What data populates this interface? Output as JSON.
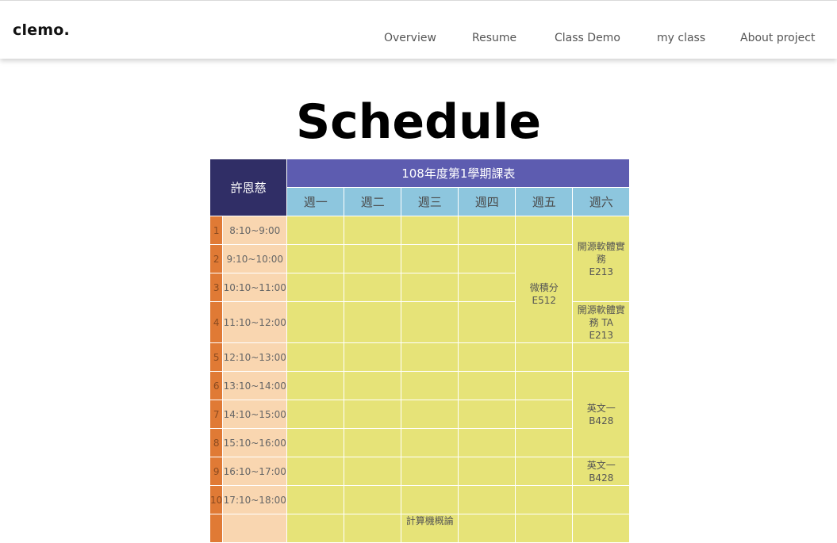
{
  "header": {
    "brand": "clemo.",
    "nav": [
      "Overview",
      "Resume",
      "Class Demo",
      "my class",
      "About project"
    ]
  },
  "page_title": "Schedule",
  "schedule": {
    "owner": "許恩慈",
    "semester_title": "108年度第1學期課表",
    "days": [
      "週一",
      "週二",
      "週三",
      "週四",
      "週五",
      "週六"
    ],
    "periods": [
      {
        "num": "1",
        "time": "8:10~9:00"
      },
      {
        "num": "2",
        "time": "9:10~10:00"
      },
      {
        "num": "3",
        "time": "10:10~11:00"
      },
      {
        "num": "4",
        "time": "11:10~12:00"
      },
      {
        "num": "5",
        "time": "12:10~13:00"
      },
      {
        "num": "6",
        "time": "13:10~14:00"
      },
      {
        "num": "7",
        "time": "14:10~15:00"
      },
      {
        "num": "8",
        "time": "15:10~16:00"
      },
      {
        "num": "9",
        "time": "16:10~17:00"
      },
      {
        "num": "10",
        "time": "17:10~18:00"
      }
    ],
    "courses": {
      "oss": {
        "name": "開源軟體實務",
        "room": "E213"
      },
      "calculus": {
        "name": "微積分",
        "room": "E512"
      },
      "oss_ta": {
        "name": "開源軟體實務 TA",
        "room": "E213"
      },
      "english_a": {
        "name": "英文一",
        "room": "B428"
      },
      "english_b": {
        "name": "英文一",
        "room": "B428"
      },
      "computer_intro": {
        "name": "計算機概論"
      }
    }
  },
  "colors": {
    "owner_bg": "#302e66",
    "semester_bg": "#5d5cb0",
    "day_bg": "#8dc6de",
    "period_num_bg": "#e07a35",
    "period_time_bg": "#f9d6b0",
    "slot_bg": "#e6e378"
  }
}
